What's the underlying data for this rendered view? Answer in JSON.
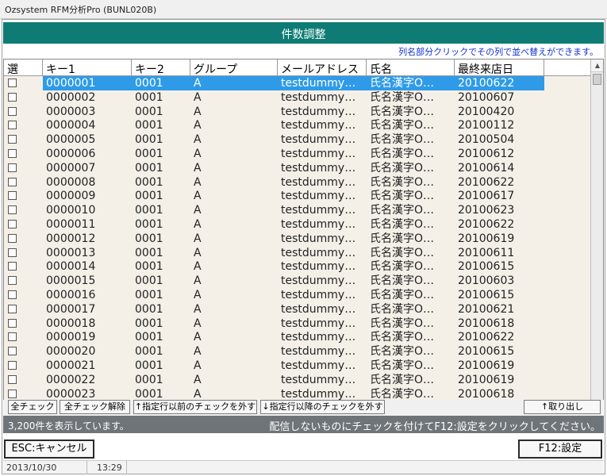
{
  "window": {
    "title": "Ozsystem RFM分析Pro (BUNL020B)"
  },
  "header": {
    "title": "件数調整",
    "sort_hint": "列名部分クリックでその列で並べ替えができます。"
  },
  "columns": [
    "選",
    "キー1",
    "キー2",
    "グループ",
    "メールアドレス",
    "氏名",
    "最終来店日"
  ],
  "rows": [
    {
      "key1": "0000001",
      "key2": "0001",
      "group": "A",
      "email": "testdummy…",
      "name": "氏名漢字O…",
      "date": "20100622",
      "selected": true
    },
    {
      "key1": "0000002",
      "key2": "0001",
      "group": "A",
      "email": "testdummy…",
      "name": "氏名漢字O…",
      "date": "20100607"
    },
    {
      "key1": "0000003",
      "key2": "0001",
      "group": "A",
      "email": "testdummy…",
      "name": "氏名漢字O…",
      "date": "20100420"
    },
    {
      "key1": "0000004",
      "key2": "0001",
      "group": "A",
      "email": "testdummy…",
      "name": "氏名漢字O…",
      "date": "20100112"
    },
    {
      "key1": "0000005",
      "key2": "0001",
      "group": "A",
      "email": "testdummy…",
      "name": "氏名漢字O…",
      "date": "20100504"
    },
    {
      "key1": "0000006",
      "key2": "0001",
      "group": "A",
      "email": "testdummy…",
      "name": "氏名漢字O…",
      "date": "20100612"
    },
    {
      "key1": "0000007",
      "key2": "0001",
      "group": "A",
      "email": "testdummy…",
      "name": "氏名漢字O…",
      "date": "20100614"
    },
    {
      "key1": "0000008",
      "key2": "0001",
      "group": "A",
      "email": "testdummy…",
      "name": "氏名漢字O…",
      "date": "20100622"
    },
    {
      "key1": "0000009",
      "key2": "0001",
      "group": "A",
      "email": "testdummy…",
      "name": "氏名漢字O…",
      "date": "20100617"
    },
    {
      "key1": "0000010",
      "key2": "0001",
      "group": "A",
      "email": "testdummy…",
      "name": "氏名漢字O…",
      "date": "20100623"
    },
    {
      "key1": "0000011",
      "key2": "0001",
      "group": "A",
      "email": "testdummy…",
      "name": "氏名漢字O…",
      "date": "20100622"
    },
    {
      "key1": "0000012",
      "key2": "0001",
      "group": "A",
      "email": "testdummy…",
      "name": "氏名漢字O…",
      "date": "20100619"
    },
    {
      "key1": "0000013",
      "key2": "0001",
      "group": "A",
      "email": "testdummy…",
      "name": "氏名漢字O…",
      "date": "20100611"
    },
    {
      "key1": "0000014",
      "key2": "0001",
      "group": "A",
      "email": "testdummy…",
      "name": "氏名漢字O…",
      "date": "20100615"
    },
    {
      "key1": "0000015",
      "key2": "0001",
      "group": "A",
      "email": "testdummy…",
      "name": "氏名漢字O…",
      "date": "20100603"
    },
    {
      "key1": "0000016",
      "key2": "0001",
      "group": "A",
      "email": "testdummy…",
      "name": "氏名漢字O…",
      "date": "20100615"
    },
    {
      "key1": "0000017",
      "key2": "0001",
      "group": "A",
      "email": "testdummy…",
      "name": "氏名漢字O…",
      "date": "20100621"
    },
    {
      "key1": "0000018",
      "key2": "0001",
      "group": "A",
      "email": "testdummy…",
      "name": "氏名漢字O…",
      "date": "20100618"
    },
    {
      "key1": "0000019",
      "key2": "0001",
      "group": "A",
      "email": "testdummy…",
      "name": "氏名漢字O…",
      "date": "20100622"
    },
    {
      "key1": "0000020",
      "key2": "0001",
      "group": "A",
      "email": "testdummy…",
      "name": "氏名漢字O…",
      "date": "20100615"
    },
    {
      "key1": "0000021",
      "key2": "0001",
      "group": "A",
      "email": "testdummy…",
      "name": "氏名漢字O…",
      "date": "20100619"
    },
    {
      "key1": "0000022",
      "key2": "0001",
      "group": "A",
      "email": "testdummy…",
      "name": "氏名漢字O…",
      "date": "20100619"
    },
    {
      "key1": "0000023",
      "key2": "0001",
      "group": "A",
      "email": "testdummy…",
      "name": "氏名漢字O…",
      "date": "20100618"
    }
  ],
  "toolbar": {
    "check_all": "全チェック",
    "uncheck_all": "全チェック解除",
    "uncheck_before": "↑指定行以前のチェックを外す",
    "uncheck_after": "↓指定行以降のチェックを外す",
    "extract": "↑取り出し"
  },
  "status": {
    "count_text": "3,200件を表示しています。",
    "instruction": "配信しないものにチェックを付けてF12:設定をクリックしてください。"
  },
  "actions": {
    "cancel": "ESC:キャンセル",
    "save": "F12:設定"
  },
  "footer": {
    "date": "2013/10/30",
    "time": "13:29"
  },
  "colors": {
    "header_band": "#0e7c74",
    "selected_row": "#2f9be8",
    "status_band": "#6f7478",
    "hint_text": "#1030d0"
  }
}
